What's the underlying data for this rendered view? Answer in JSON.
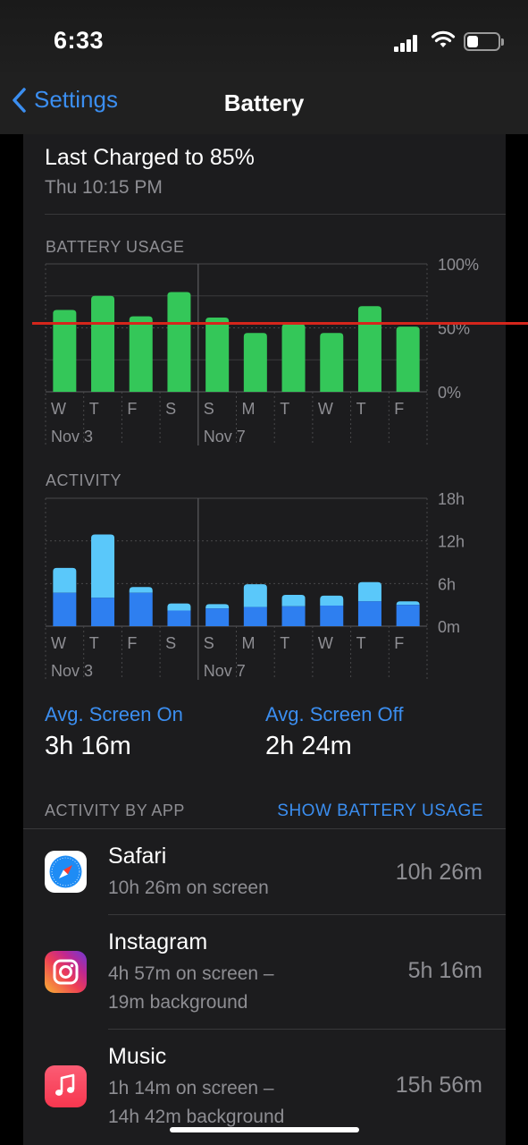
{
  "status_bar": {
    "time": "6:33"
  },
  "nav": {
    "back_label": "Settings",
    "title": "Battery"
  },
  "last_charged": {
    "title": "Last Charged to 85%",
    "date": "Thu 10:15 PM"
  },
  "battery_usage": {
    "label": "BATTERY USAGE",
    "y_ticks": [
      "100%",
      "50%",
      "0%"
    ],
    "days": [
      "W",
      "T",
      "F",
      "S",
      "S",
      "M",
      "T",
      "W",
      "T",
      "F"
    ],
    "dates": [
      "Nov 3",
      "Nov 7"
    ],
    "bar_color": "#34c759"
  },
  "activity": {
    "label": "ACTIVITY",
    "y_ticks": [
      "18h",
      "12h",
      "6h",
      "0m"
    ],
    "days": [
      "W",
      "T",
      "F",
      "S",
      "S",
      "M",
      "T",
      "W",
      "T",
      "F"
    ],
    "dates": [
      "Nov 3",
      "Nov 7"
    ],
    "screen_on_color": "#2e7ff0",
    "screen_off_color": "#5ac8fa"
  },
  "chart_data": [
    {
      "type": "bar",
      "title": "BATTERY USAGE",
      "categories": [
        "W",
        "T",
        "F",
        "S",
        "S",
        "M",
        "T",
        "W",
        "T",
        "F"
      ],
      "values": [
        64,
        75,
        59,
        78,
        58,
        46,
        53,
        46,
        67,
        51
      ],
      "ylim": [
        0,
        100
      ],
      "y_unit": "%",
      "grid": true
    },
    {
      "type": "bar",
      "title": "ACTIVITY",
      "categories": [
        "W",
        "T",
        "F",
        "S",
        "S",
        "M",
        "T",
        "W",
        "T",
        "F"
      ],
      "stacked": true,
      "series": [
        {
          "values": [
            4.7,
            4.0,
            4.7,
            2.2,
            2.5,
            2.7,
            2.8,
            2.9,
            3.5,
            3.0
          ]
        },
        {
          "values": [
            3.5,
            8.9,
            0.8,
            1.0,
            0.6,
            3.2,
            1.6,
            1.4,
            2.7,
            0.5
          ]
        }
      ],
      "ylim": [
        0,
        18
      ],
      "y_unit": "h",
      "grid": true
    }
  ],
  "averages": {
    "screen_on_label": "Avg. Screen On",
    "screen_on_value": "3h 16m",
    "screen_off_label": "Avg. Screen Off",
    "screen_off_value": "2h 24m"
  },
  "activity_by_app": {
    "label": "ACTIVITY BY APP",
    "action": "SHOW BATTERY USAGE",
    "apps": [
      {
        "name": "Safari",
        "line1": "10h 26m on screen",
        "line2": "",
        "total": "10h 26m",
        "icon": "safari-icon"
      },
      {
        "name": "Instagram",
        "line1": "4h 57m on screen –",
        "line2": "19m background",
        "total": "5h 16m",
        "icon": "instagram-icon"
      },
      {
        "name": "Music",
        "line1": "1h 14m on screen –",
        "line2": "14h 42m background",
        "total": "15h 56m",
        "icon": "music-icon"
      }
    ]
  }
}
